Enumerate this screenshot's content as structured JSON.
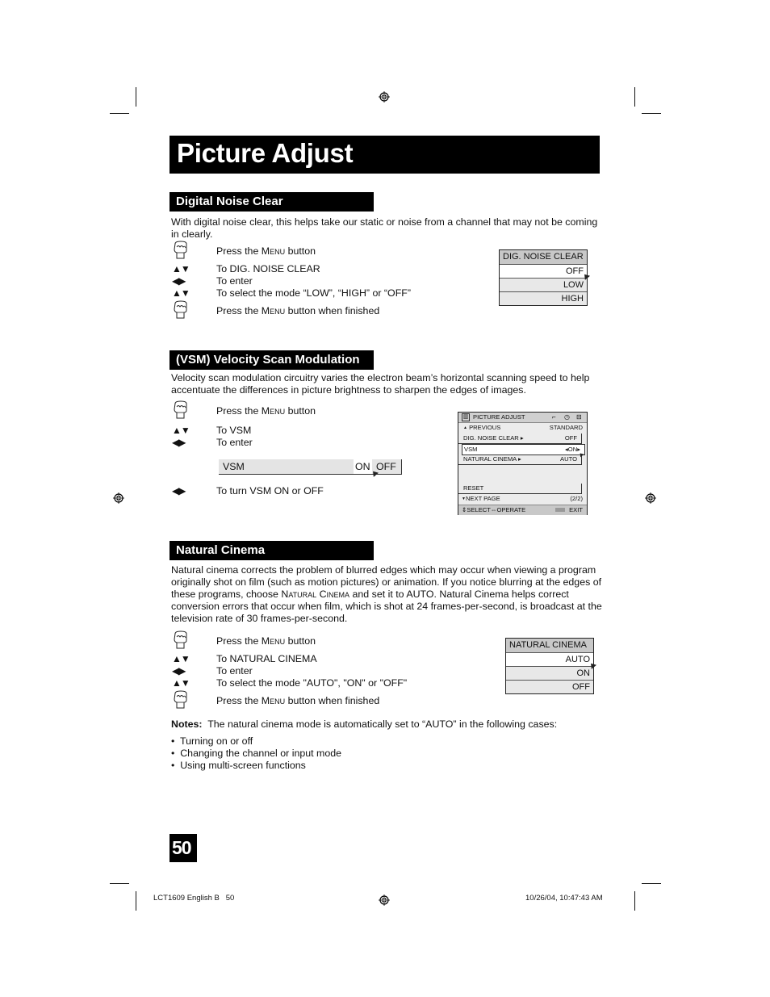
{
  "page": {
    "title": "Picture Adjust",
    "page_number": "50",
    "footer_left": "LCT1609 English B   50",
    "footer_right": "10/26/04, 10:47:43 AM"
  },
  "icons": {
    "menu_button": "hand-press-icon",
    "up_down": "▲▼",
    "left_right": "◀▶",
    "registration": "registration-mark-icon"
  },
  "dnc": {
    "heading": "Digital Noise Clear",
    "description": "With digital noise clear, this helps take our static or noise from a channel that may not be coming in clearly.",
    "steps": [
      {
        "icon": "menu",
        "pre": "Press the ",
        "sc": "Menu",
        "post": " button"
      },
      {
        "icon": "updown",
        "text": "To DIG. NOISE CLEAR"
      },
      {
        "icon": "leftright",
        "text": "To enter"
      },
      {
        "icon": "updown",
        "text": "To select the mode “LOW”,  “HIGH” or “OFF”"
      },
      {
        "icon": "menu",
        "pre": "Press the ",
        "sc": "Menu",
        "post": " button when finished"
      }
    ],
    "osd": {
      "header": "DIG. NOISE CLEAR",
      "options": [
        "OFF",
        "LOW",
        "HIGH"
      ],
      "selected": "OFF"
    }
  },
  "vsm": {
    "heading": "(VSM) Velocity Scan Modulation",
    "description": "Velocity scan modulation circuitry varies the electron beam’s horizontal scanning speed to help accentuate the differences in picture brightness to sharpen the edges of images.",
    "steps": [
      {
        "icon": "menu",
        "pre": "Press the ",
        "sc": "Menu",
        "post": " button"
      },
      {
        "icon": "updown",
        "text": "To VSM"
      },
      {
        "icon": "leftright",
        "text": "To enter"
      },
      {
        "icon": "leftright",
        "text": "To turn VSM ON or OFF"
      }
    ],
    "bar": {
      "label": "VSM",
      "on": "ON",
      "off": "OFF",
      "selected": "ON"
    },
    "menu": {
      "title": "PICTURE ADJUST",
      "previous": "PREVIOUS",
      "previous_value": "STANDARD",
      "items": [
        {
          "label": "DIG. NOISE CLEAR",
          "value": "OFF"
        },
        {
          "label": "VSM",
          "value": "ON"
        },
        {
          "label": "NATURAL CINEMA",
          "value": "AUTO"
        }
      ],
      "reset": "RESET",
      "next_page": "NEXT PAGE",
      "page_indicator": "(2/2)",
      "footer_select": "SELECT",
      "footer_operate": "OPERATE",
      "footer_menu": "MENU",
      "footer_exit": "EXIT"
    }
  },
  "nc": {
    "heading": "Natural Cinema",
    "description_parts": [
      "Natural cinema corrects the problem of blurred edges which may occur when viewing a program originally shot on film (such as motion pictures) or animation. If you notice blurring at the edges of these programs, choose ",
      "Natural Cinema",
      " and set it to AUTO. Natural Cinema helps correct conversion errors that occur when film, which is shot at 24 frames-per-second, is broadcast at the television rate of 30 frames-per-second."
    ],
    "steps": [
      {
        "icon": "menu",
        "pre": "Press the ",
        "sc": "Menu",
        "post": " button"
      },
      {
        "icon": "updown",
        "text": "To NATURAL CINEMA"
      },
      {
        "icon": "leftright",
        "text": "To enter"
      },
      {
        "icon": "updown",
        "text": "To select the mode \"AUTO\", \"ON\" or \"OFF\""
      },
      {
        "icon": "menu",
        "pre": "Press the ",
        "sc": "Menu",
        "post": " button when finished"
      }
    ],
    "osd": {
      "header": "NATURAL CINEMA",
      "options": [
        "AUTO",
        "ON",
        "OFF"
      ],
      "selected": "AUTO"
    },
    "notes_label": "Notes:",
    "notes_text": "  The natural cinema mode is automatically set to “AUTO” in the following cases:",
    "bullets": [
      "Turning on or off",
      "Changing the channel or input mode",
      "Using multi-screen functions"
    ]
  }
}
